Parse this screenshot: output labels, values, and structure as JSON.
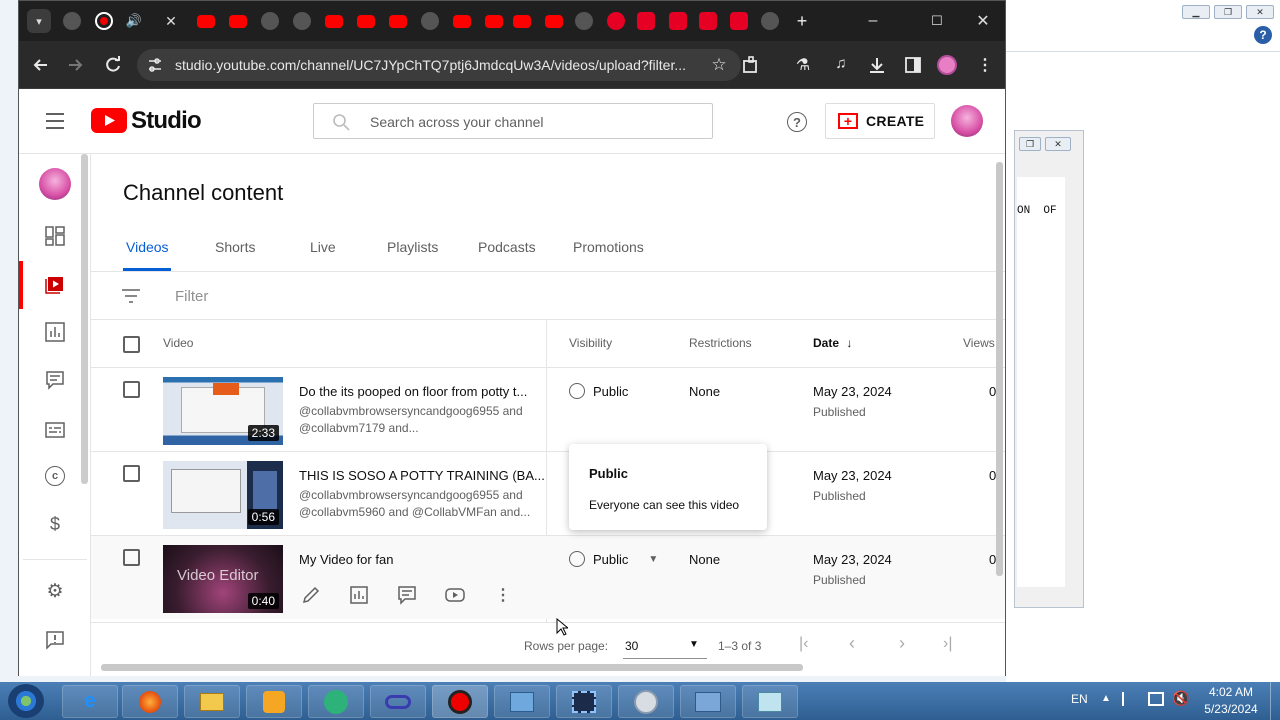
{
  "browser": {
    "url": "studio.youtube.com/channel/UC7JYpChTQ7ptj6JmdcqUw3A/videos/upload?filter...",
    "close_tab": "✕",
    "new_tab": "+"
  },
  "background_window": {
    "text": "ON  OF"
  },
  "studio": {
    "logo_text": "Studio",
    "search_placeholder": "Search across your channel",
    "create_label": "CREATE",
    "page_title": "Channel content",
    "tabs": [
      "Videos",
      "Shorts",
      "Live",
      "Playlists",
      "Podcasts",
      "Promotions"
    ],
    "filter_placeholder": "Filter",
    "columns": {
      "video": "Video",
      "visibility": "Visibility",
      "restrictions": "Restrictions",
      "date": "Date",
      "views": "Views"
    },
    "rows": [
      {
        "title": "Do the its pooped on floor from potty t...",
        "desc1": "@collabvmbrowsersyncandgoog6955 and",
        "desc2": "@collabvm7179 and...",
        "duration": "2:33",
        "visibility": "Public",
        "restrictions": "None",
        "date": "May 23, 2024",
        "status": "Published",
        "views": "0"
      },
      {
        "title": "THIS IS SOSO A POTTY TRAINING (BA...",
        "desc1": "@collabvmbrowsersyncandgoog6955 and",
        "desc2": "@collabvm5960 and @CollabVMFan and...",
        "duration": "0:56",
        "date": "May 23, 2024",
        "status": "Published",
        "views": "0"
      },
      {
        "title": "My Video for fan",
        "duration": "0:40",
        "thumb_text": "Video Editor",
        "visibility": "Public",
        "restrictions": "None",
        "date": "May 23, 2024",
        "status": "Published",
        "views": "0"
      }
    ],
    "popup": {
      "title": "Public",
      "text": "Everyone can see this video"
    },
    "pager": {
      "rows_per_page_label": "Rows per page:",
      "rows_per_page": "30",
      "range": "1–3 of 3"
    }
  },
  "taskbar": {
    "lang": "EN",
    "time": "4:02 AM",
    "date": "5/23/2024"
  },
  "colors": {
    "accent_blue": "#065fd4",
    "youtube_red": "#ff0000"
  }
}
